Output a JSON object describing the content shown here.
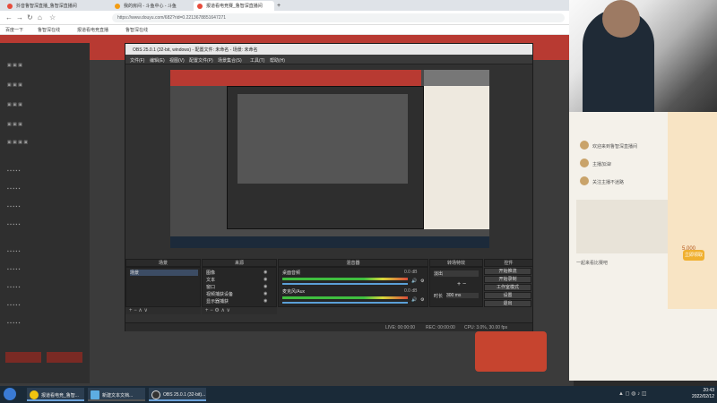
{
  "browser": {
    "tabs": [
      {
        "label": "抖音鲁智深直播_鲁智深直播间"
      },
      {
        "label": "我的房间 - 斗鱼中心 - 斗鱼"
      },
      {
        "label": "报道看电竞赛_鲁智深直播间"
      }
    ],
    "new_tab": "+",
    "url": "https://www.douyu.com/682?rid=0.2213678851647271",
    "bookmarks": [
      "百度一下",
      "鲁智深在线",
      "报道看电竞直播",
      "鲁智深在线"
    ]
  },
  "obs": {
    "title": "OBS 25.0.1 (32-bit, windows) - 配置文件: 未命名 - 场景: 未命名",
    "menu": [
      "文件(F)",
      "编辑(E)",
      "视图(V)",
      "配置文件(P)",
      "场景集合(S)",
      "工具(T)",
      "帮助(H)"
    ],
    "docks": {
      "scenes": {
        "header": "场景",
        "items": [
          "场景"
        ]
      },
      "sources": {
        "header": "来源",
        "items": [
          "图像",
          "文本",
          "窗口",
          "视频捕获设备",
          "显示器捕获"
        ]
      },
      "mixer": {
        "header": "混音器",
        "channels": [
          {
            "name": "桌面音频",
            "db": "0.0 dB"
          },
          {
            "name": "麦克风/Aux",
            "db": "0.0 dB"
          }
        ]
      },
      "transitions": {
        "header": "转场特效",
        "type": "淡出",
        "duration_label": "时长",
        "duration_value": "300 ms"
      },
      "controls": {
        "header": "控件",
        "buttons": [
          "开始推流",
          "开始录制",
          "工作室模式",
          "设置",
          "退出"
        ]
      }
    },
    "status": {
      "live": "LIVE: 00:00:00",
      "rec": "REC: 00:00:00",
      "cpu": "CPU: 3.0%, 30.00 fps"
    }
  },
  "chat": {
    "messages": [
      "欢迎来到鲁智深直播间",
      "主播加油!",
      "关注主播不迷路",
      "一起来看比赛吧"
    ]
  },
  "promo": {
    "badge": "5,000",
    "button": "立即领取"
  },
  "taskbar": {
    "items": [
      "报道看电竞_鲁智...",
      "新建文本文档...",
      "OBS 25.0.1 (32-bit)..."
    ],
    "time": "20:43",
    "date": "2022/02/12"
  }
}
